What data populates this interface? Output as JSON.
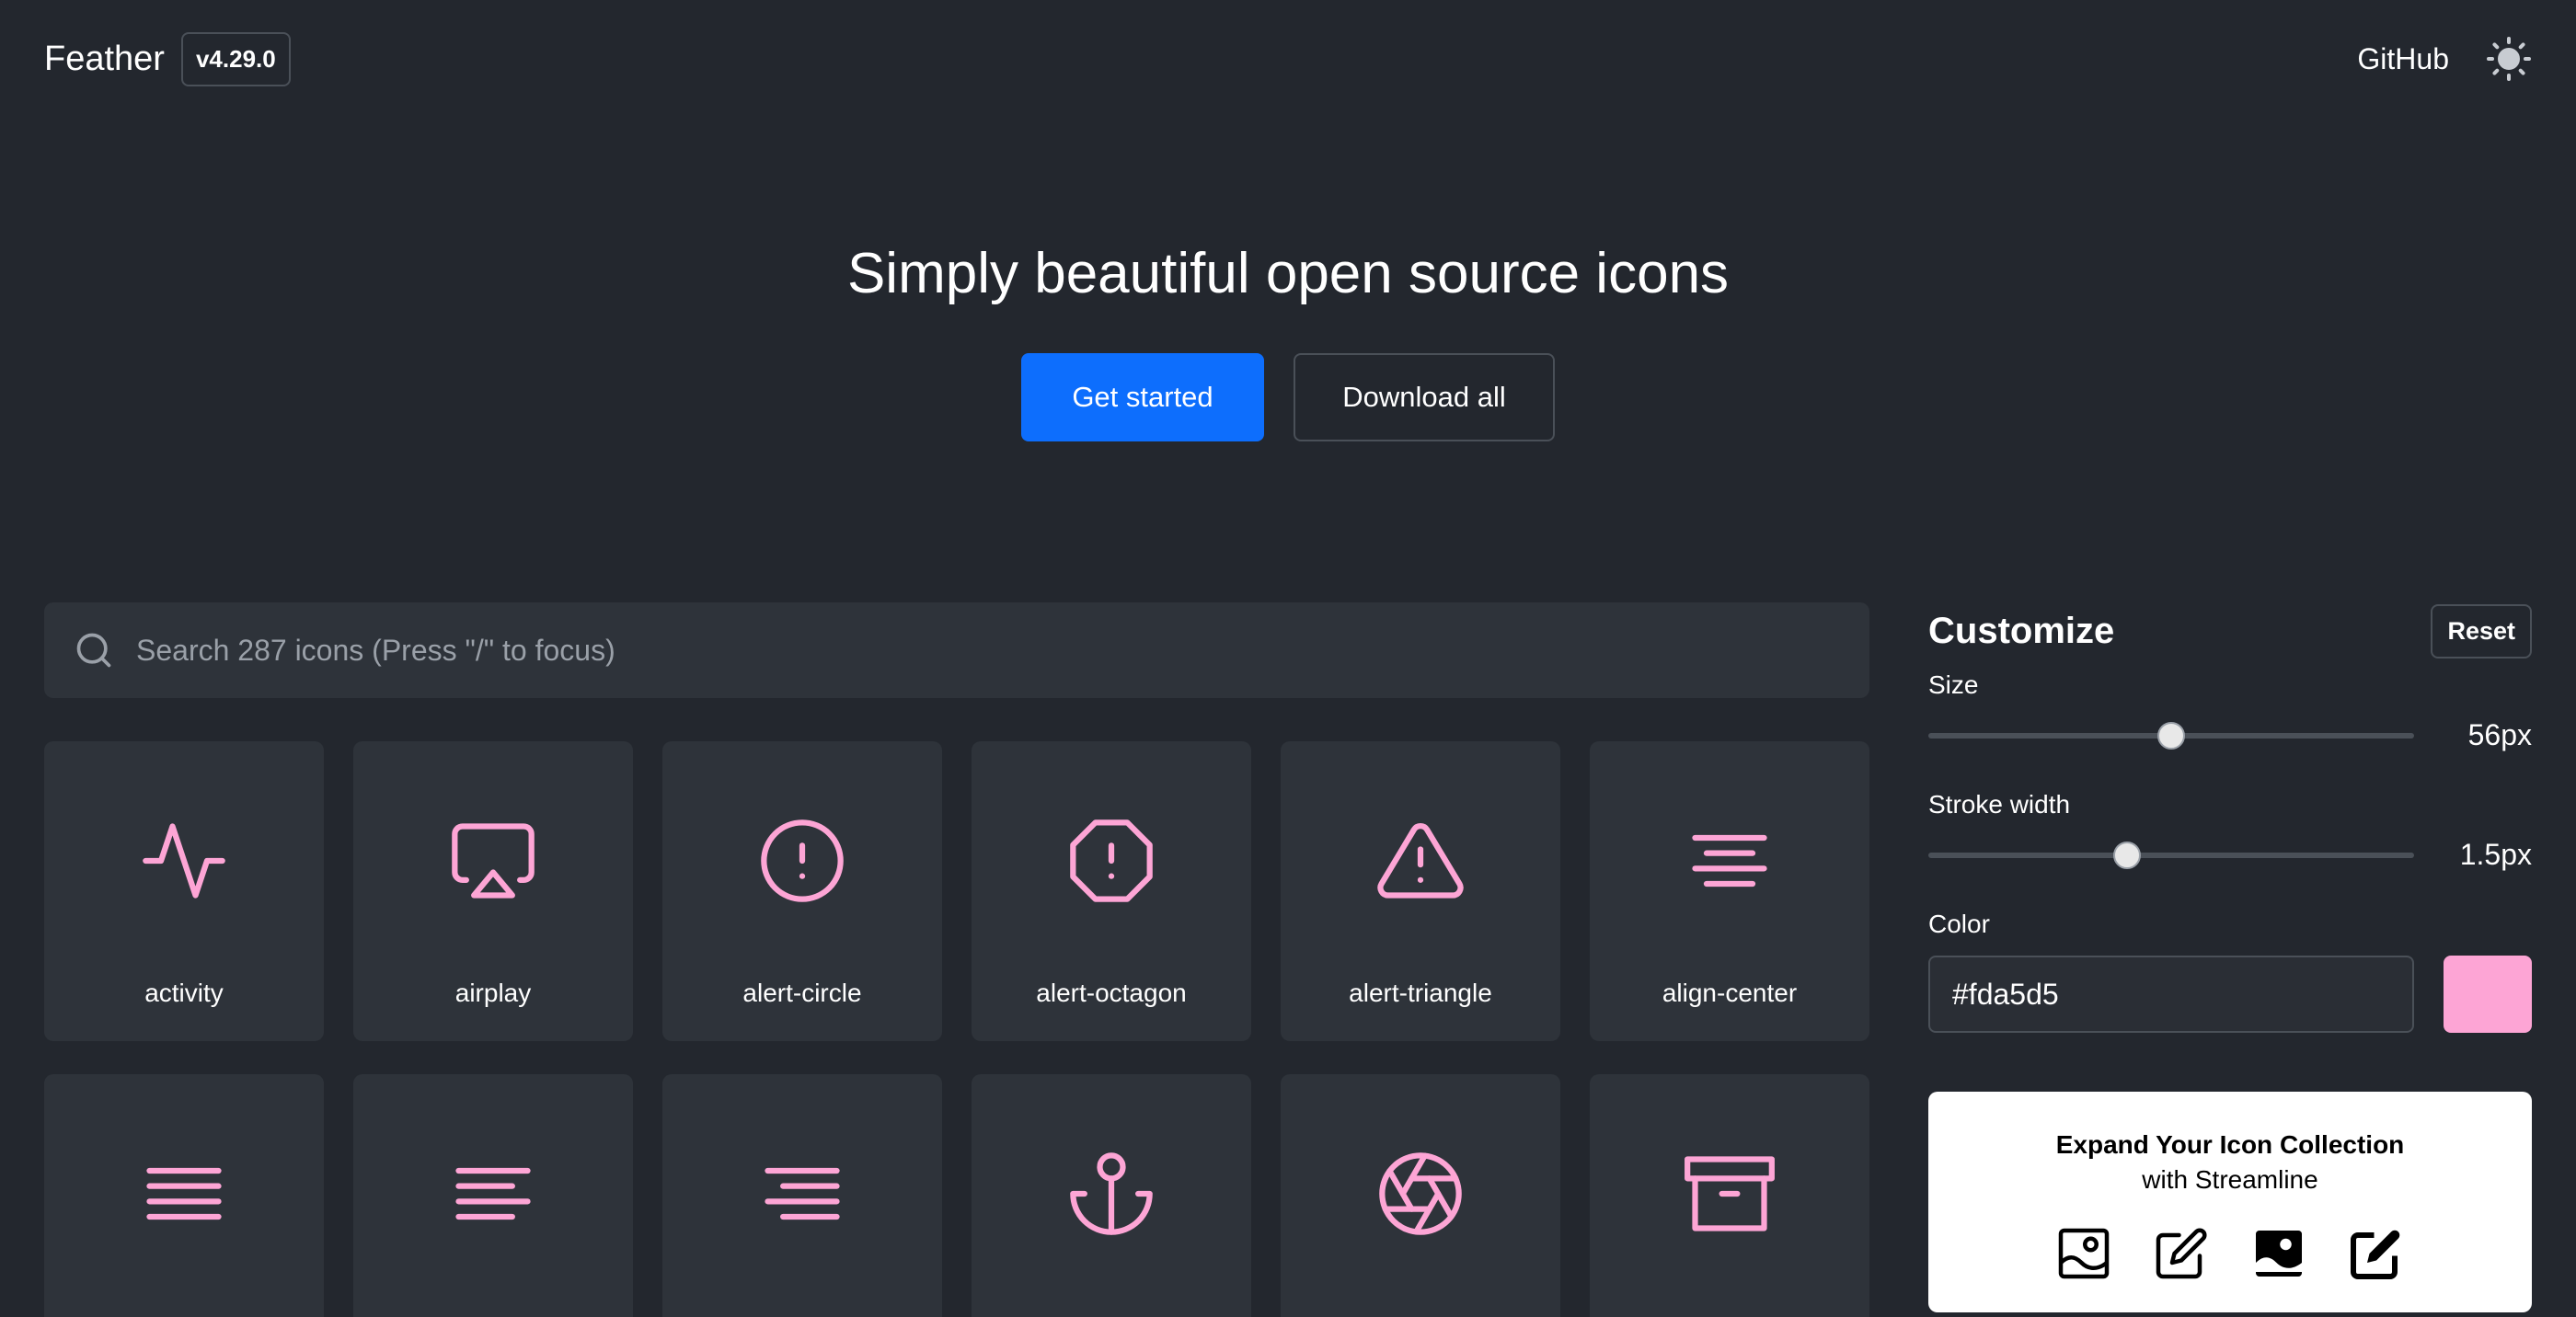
{
  "header": {
    "logo": "Feather",
    "version": "v4.29.0",
    "github": "GitHub"
  },
  "hero": {
    "title": "Simply beautiful open source icons",
    "primary_button": "Get started",
    "secondary_button": "Download all"
  },
  "search": {
    "placeholder": "Search 287 icons (Press \"/\" to focus)"
  },
  "icons": [
    {
      "label": "activity",
      "icon": "activity-icon"
    },
    {
      "label": "airplay",
      "icon": "airplay-icon"
    },
    {
      "label": "alert-circle",
      "icon": "alert-circle-icon"
    },
    {
      "label": "alert-octagon",
      "icon": "alert-octagon-icon"
    },
    {
      "label": "alert-triangle",
      "icon": "alert-triangle-icon"
    },
    {
      "label": "align-center",
      "icon": "align-center-icon"
    },
    {
      "label": "",
      "icon": "align-justify-icon"
    },
    {
      "label": "",
      "icon": "align-left-icon"
    },
    {
      "label": "",
      "icon": "align-right-icon"
    },
    {
      "label": "",
      "icon": "anchor-icon"
    },
    {
      "label": "",
      "icon": "aperture-icon"
    },
    {
      "label": "",
      "icon": "archive-icon"
    }
  ],
  "customize": {
    "title": "Customize",
    "reset": "Reset",
    "size_label": "Size",
    "size_value": "56px",
    "size_fraction": 0.5,
    "stroke_label": "Stroke width",
    "stroke_value": "1.5px",
    "stroke_fraction": 0.41,
    "color_label": "Color",
    "color_value": "#fda5d5"
  },
  "promo": {
    "title": "Expand Your Icon Collection",
    "subtitle": "with Streamline"
  },
  "colors": {
    "background": "#23272e",
    "card": "#2e333a",
    "accent": "#0d6efd",
    "icon_stroke": "#fda5d5"
  }
}
